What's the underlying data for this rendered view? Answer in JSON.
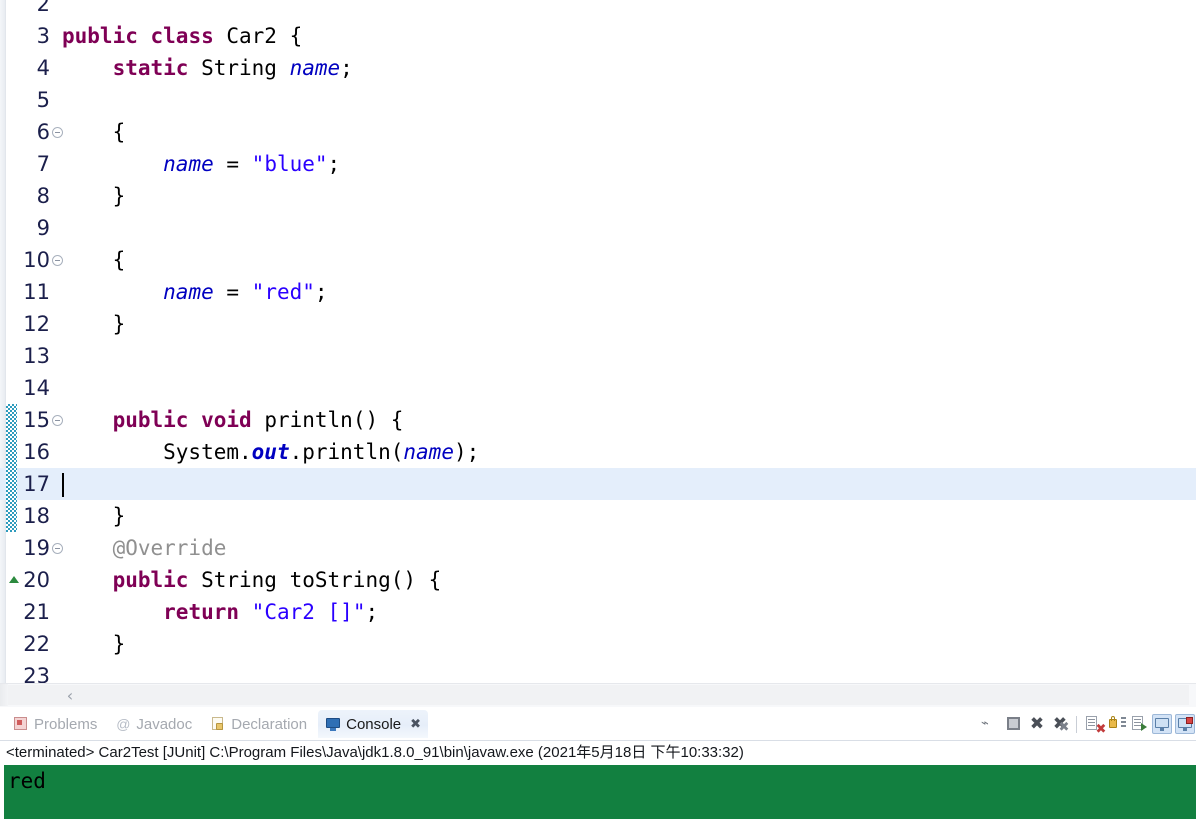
{
  "editor": {
    "lines": [
      {
        "num": "2",
        "indent": 0,
        "fold": false,
        "changed": false,
        "current": false,
        "tokens": []
      },
      {
        "num": "3",
        "indent": 0,
        "fold": false,
        "changed": false,
        "current": false,
        "tokens": [
          {
            "t": "public",
            "c": "kw"
          },
          {
            "t": " ",
            "c": "plain"
          },
          {
            "t": "class",
            "c": "kw"
          },
          {
            "t": " Car2 {",
            "c": "plain"
          }
        ]
      },
      {
        "num": "4",
        "indent": 0,
        "fold": false,
        "changed": false,
        "current": false,
        "tokens": [
          {
            "t": "    ",
            "c": "plain"
          },
          {
            "t": "static",
            "c": "kw"
          },
          {
            "t": " String ",
            "c": "plain"
          },
          {
            "t": "name",
            "c": "fieldi"
          },
          {
            "t": ";",
            "c": "plain"
          }
        ]
      },
      {
        "num": "5",
        "indent": 0,
        "fold": false,
        "changed": false,
        "current": false,
        "tokens": []
      },
      {
        "num": "6",
        "indent": 0,
        "fold": true,
        "changed": false,
        "current": false,
        "tokens": [
          {
            "t": "    {",
            "c": "plain"
          }
        ]
      },
      {
        "num": "7",
        "indent": 0,
        "fold": false,
        "changed": false,
        "current": false,
        "tokens": [
          {
            "t": "        ",
            "c": "plain"
          },
          {
            "t": "name",
            "c": "fieldi"
          },
          {
            "t": " = ",
            "c": "plain"
          },
          {
            "t": "\"blue\"",
            "c": "str"
          },
          {
            "t": ";",
            "c": "plain"
          }
        ]
      },
      {
        "num": "8",
        "indent": 0,
        "fold": false,
        "changed": false,
        "current": false,
        "tokens": [
          {
            "t": "    }",
            "c": "plain"
          }
        ]
      },
      {
        "num": "9",
        "indent": 0,
        "fold": false,
        "changed": false,
        "current": false,
        "tokens": []
      },
      {
        "num": "10",
        "indent": 0,
        "fold": true,
        "changed": false,
        "current": false,
        "tokens": [
          {
            "t": "    {",
            "c": "plain"
          }
        ]
      },
      {
        "num": "11",
        "indent": 0,
        "fold": false,
        "changed": false,
        "current": false,
        "tokens": [
          {
            "t": "        ",
            "c": "plain"
          },
          {
            "t": "name",
            "c": "fieldi"
          },
          {
            "t": " = ",
            "c": "plain"
          },
          {
            "t": "\"red\"",
            "c": "str"
          },
          {
            "t": ";",
            "c": "plain"
          }
        ]
      },
      {
        "num": "12",
        "indent": 0,
        "fold": false,
        "changed": false,
        "current": false,
        "tokens": [
          {
            "t": "    }",
            "c": "plain"
          }
        ]
      },
      {
        "num": "13",
        "indent": 0,
        "fold": false,
        "changed": false,
        "current": false,
        "tokens": []
      },
      {
        "num": "14",
        "indent": 0,
        "fold": false,
        "changed": false,
        "current": false,
        "tokens": []
      },
      {
        "num": "15",
        "indent": 0,
        "fold": true,
        "changed": true,
        "current": false,
        "tokens": [
          {
            "t": "    ",
            "c": "plain"
          },
          {
            "t": "public",
            "c": "kw"
          },
          {
            "t": " ",
            "c": "plain"
          },
          {
            "t": "void",
            "c": "kw"
          },
          {
            "t": " println() {",
            "c": "plain"
          }
        ]
      },
      {
        "num": "16",
        "indent": 0,
        "fold": false,
        "changed": true,
        "current": false,
        "tokens": [
          {
            "t": "        System.",
            "c": "plain"
          },
          {
            "t": "out",
            "c": "fieldbi"
          },
          {
            "t": ".println(",
            "c": "plain"
          },
          {
            "t": "name",
            "c": "fieldi"
          },
          {
            "t": ");",
            "c": "plain"
          }
        ]
      },
      {
        "num": "17",
        "indent": 0,
        "fold": false,
        "changed": true,
        "current": true,
        "caret": true,
        "tokens": []
      },
      {
        "num": "18",
        "indent": 0,
        "fold": false,
        "changed": true,
        "current": false,
        "tokens": [
          {
            "t": "    }",
            "c": "plain"
          }
        ]
      },
      {
        "num": "19",
        "indent": 0,
        "fold": true,
        "changed": false,
        "current": false,
        "tokens": [
          {
            "t": "    @Override",
            "c": "anno"
          }
        ]
      },
      {
        "num": "20",
        "indent": 0,
        "fold": false,
        "changed": false,
        "current": false,
        "overrideMarker": true,
        "tokens": [
          {
            "t": "    ",
            "c": "plain"
          },
          {
            "t": "public",
            "c": "kw"
          },
          {
            "t": " String toString() {",
            "c": "plain"
          }
        ]
      },
      {
        "num": "21",
        "indent": 0,
        "fold": false,
        "changed": false,
        "current": false,
        "tokens": [
          {
            "t": "        ",
            "c": "plain"
          },
          {
            "t": "return",
            "c": "kw"
          },
          {
            "t": " ",
            "c": "plain"
          },
          {
            "t": "\"Car2 []\"",
            "c": "str"
          },
          {
            "t": ";",
            "c": "plain"
          }
        ]
      },
      {
        "num": "22",
        "indent": 0,
        "fold": false,
        "changed": false,
        "current": false,
        "tokens": [
          {
            "t": "    }",
            "c": "plain"
          }
        ]
      },
      {
        "num": "23",
        "indent": 0,
        "fold": false,
        "changed": false,
        "current": false,
        "tokens": []
      }
    ],
    "scrollbar": {
      "left_arrow": "‹"
    }
  },
  "bottom_panel": {
    "tabs": [
      {
        "label": "Problems",
        "icon": "problems-icon",
        "active": false,
        "closable": false
      },
      {
        "label": "Javadoc",
        "icon": "javadoc-icon",
        "active": false,
        "closable": false
      },
      {
        "label": "Declaration",
        "icon": "declaration-icon",
        "active": false,
        "closable": false
      },
      {
        "label": "Console",
        "icon": "console-icon",
        "active": true,
        "closable": true,
        "close_glyph": "✖"
      }
    ],
    "toolbar": [
      {
        "name": "terminate-all-icon"
      },
      {
        "name": "stop-icon"
      },
      {
        "name": "remove-launch-icon"
      },
      {
        "name": "remove-all-terminated-icon"
      },
      {
        "name": "clear-console-icon"
      },
      {
        "name": "scroll-lock-icon"
      },
      {
        "name": "word-wrap-icon"
      },
      {
        "name": "pin-console-icon"
      },
      {
        "name": "display-selected-console-icon"
      },
      {
        "name": "open-console-icon"
      }
    ],
    "status_line": "<terminated> Car2Test [JUnit] C:\\Program Files\\Java\\jdk1.8.0_91\\bin\\javaw.exe (2021年5月18日 下午10:33:32)",
    "console_output": "red"
  },
  "colors": {
    "keyword": "#7f0055",
    "string": "#2a00ff",
    "field": "#0000c0",
    "annotation": "#909090",
    "line_number": "#1b1f4b",
    "current_line_bg": "#e4eefb",
    "console_bg": "#128040",
    "change_bar": "#2e9bbd",
    "override_marker": "#2b8a3e",
    "tab_active_text": "#1a1a1a",
    "tab_inactive_text": "#a5a9b0"
  }
}
